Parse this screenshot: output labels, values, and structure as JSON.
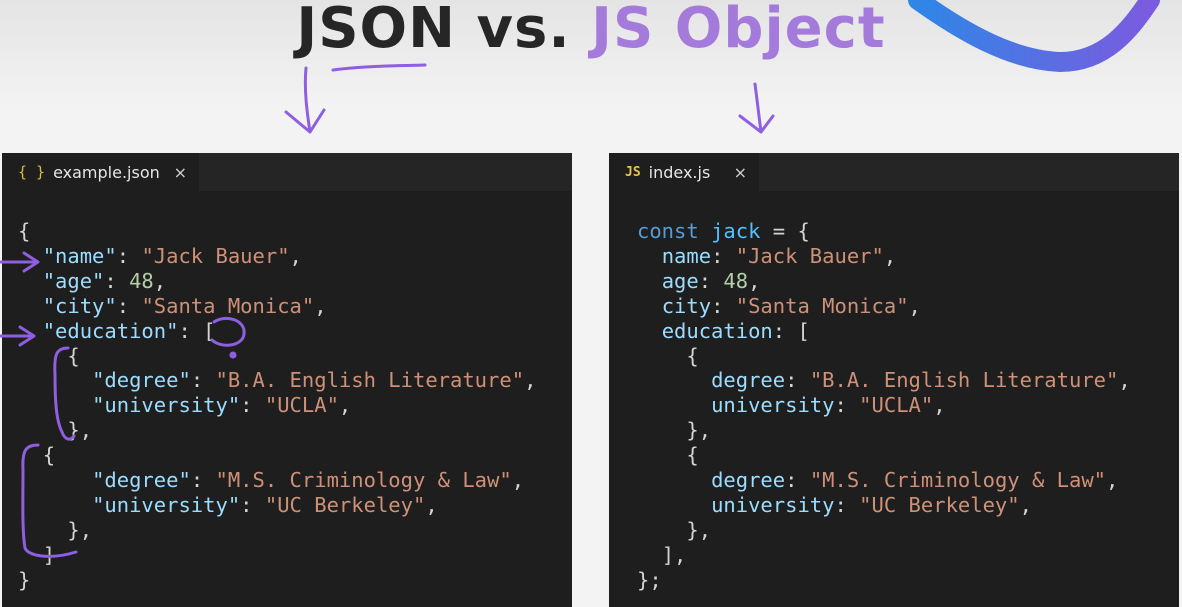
{
  "title": {
    "part1": "JSON",
    "part2": "vs.",
    "part3": "JS Object"
  },
  "left_editor": {
    "tab_icon": "{ }",
    "tab_label": "example.json",
    "close_icon": "×",
    "code": {
      "open_brace": "{",
      "name_key": "\"name\"",
      "name_value": "\"Jack Bauer\"",
      "age_key": "\"age\"",
      "age_value": "48",
      "city_key": "\"city\"",
      "city_value": "\"Santa Monica\"",
      "education_key": "\"education\"",
      "open_bracket": "[",
      "obj_open": "{",
      "degree_key": "\"degree\"",
      "degree1_value": "\"B.A. English Literature\"",
      "university_key": "\"university\"",
      "university1_value": "\"UCLA\"",
      "obj_close": "},",
      "degree2_value": "\"M.S. Criminology & Law\"",
      "university2_value": "\"UC Berkeley\"",
      "close_bracket": "]",
      "close_brace": "}"
    }
  },
  "right_editor": {
    "tab_icon": "JS",
    "tab_label": "index.js",
    "close_icon": "×",
    "code": {
      "keyword": "const",
      "var_name": "jack",
      "equals_brace": "= {",
      "name_key": "name",
      "name_value": "\"Jack Bauer\"",
      "age_key": "age",
      "age_value": "48",
      "city_key": "city",
      "city_value": "\"Santa Monica\"",
      "education_key": "education",
      "open_bracket": "[",
      "obj_open": "{",
      "degree_key": "degree",
      "degree1_value": "\"B.A. English Literature\"",
      "university_key": "university",
      "university1_value": "\"UCLA\"",
      "obj_close": "},",
      "degree2_value": "\"M.S. Criminology & Law\"",
      "university2_value": "\"UC Berkeley\"",
      "close_bracket": "],",
      "close_brace": "};"
    }
  },
  "colors": {
    "editor_bg": "#1e1e1e",
    "key": "#9cdcfe",
    "string": "#ce9178",
    "number": "#b5cea8",
    "keyword": "#569cd6",
    "annotation": "#8e5fe0",
    "title_accent": "#a47bdb"
  }
}
